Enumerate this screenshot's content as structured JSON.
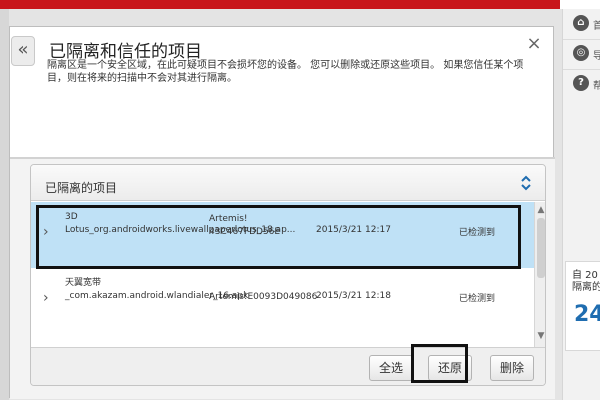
{
  "window": {
    "title": "已隔离和信任的项目",
    "description": "隔离区是一个安全区域，在此可疑项目不会损坏您的设备。 您可以删除或还原这些项目。 如果您信任某个项目，则在将来的扫描中不会对其进行隔离。",
    "back_icon": "«",
    "close_icon": "×"
  },
  "quarantine": {
    "title": "已隔离的项目",
    "collapse_icon": "⌃⌄",
    "items": [
      {
        "name": "3D Lotus_org.androidworks.livewallpaperlotus_18.ap...",
        "threat": "Artemis! 43C467FDD56E",
        "date": "2015/3/21 12:17",
        "status": "已检测到"
      },
      {
        "name": "天翼宽带_com.akazam.android.wlandialer_16.apk",
        "threat": "Artemis!E0093D049086",
        "date": "2015/3/21 12:18",
        "status": "已检测到"
      }
    ],
    "buttons": {
      "select_all": "全选",
      "restore": "还原",
      "delete": "删除"
    }
  },
  "sidebar": {
    "items": [
      {
        "icon": "home-icon",
        "glyph": "⌂",
        "label": "首"
      },
      {
        "icon": "compass-icon",
        "glyph": "◎",
        "label": "导"
      },
      {
        "icon": "help-icon",
        "glyph": "?",
        "label": "帮"
      }
    ],
    "panel": {
      "line1": "自 20",
      "line2": "隔离的",
      "count": "24"
    }
  }
}
